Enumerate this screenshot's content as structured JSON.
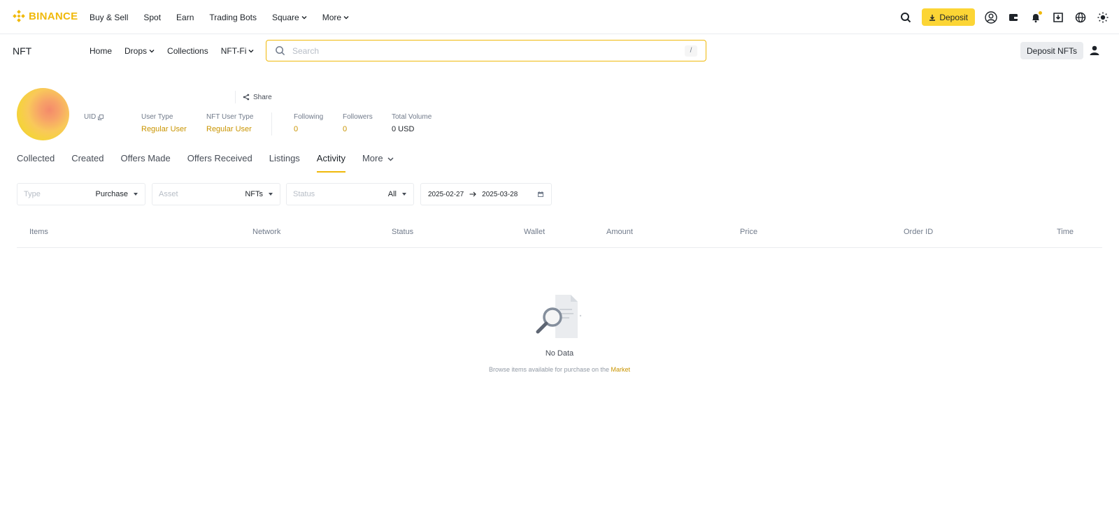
{
  "topnav": {
    "brand": "BINANCE",
    "links": [
      "Buy & Sell",
      "Spot",
      "Earn",
      "Trading Bots",
      "Square",
      "More"
    ],
    "deposit_label": "Deposit"
  },
  "subnav": {
    "section": "NFT",
    "links": [
      "Home",
      "Drops",
      "Collections",
      "NFT-Fi"
    ],
    "search_placeholder": "Search",
    "search_shortcut": "/",
    "deposit_nfts_label": "Deposit NFTs"
  },
  "profile": {
    "share_label": "Share",
    "uid_label": "UID",
    "user_type_label": "User Type",
    "user_type_value": "Regular User",
    "nft_user_type_label": "NFT User Type",
    "nft_user_type_value": "Regular User",
    "following_label": "Following",
    "following_value": "0",
    "followers_label": "Followers",
    "followers_value": "0",
    "total_volume_label": "Total Volume",
    "total_volume_value": "0 USD"
  },
  "tabs": [
    "Collected",
    "Created",
    "Offers Made",
    "Offers Received",
    "Listings",
    "Activity",
    "More"
  ],
  "active_tab": "Activity",
  "filters": {
    "type": {
      "placeholder": "Type",
      "value": "Purchase"
    },
    "asset": {
      "placeholder": "Asset",
      "value": "NFTs"
    },
    "status": {
      "placeholder": "Status",
      "value": "All"
    },
    "date_from": "2025-02-27",
    "date_to": "2025-03-28"
  },
  "table": {
    "columns": [
      "Items",
      "Network",
      "Status",
      "Wallet",
      "Amount",
      "Price",
      "Order ID",
      "Time"
    ]
  },
  "empty": {
    "title": "No Data",
    "hint": "Browse items available for purchase on the",
    "link": "Market"
  },
  "colors": {
    "accent": "#f0b90b",
    "deposit_button": "#fcd535",
    "value_yellow": "#c99400"
  }
}
